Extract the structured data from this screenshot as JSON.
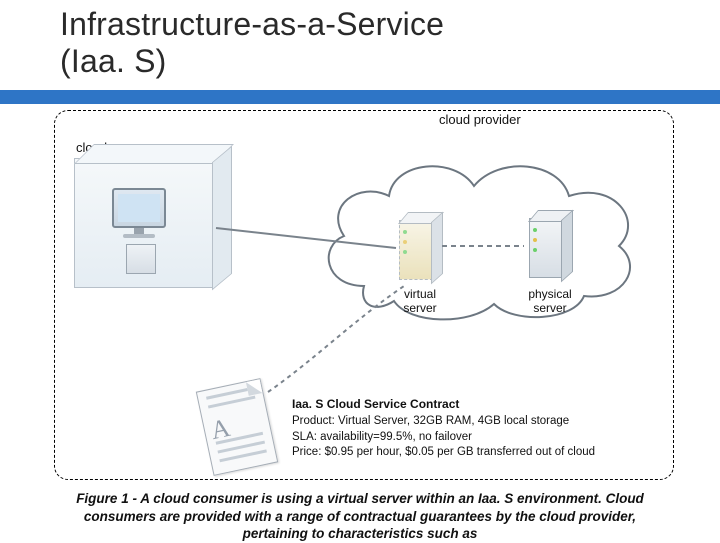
{
  "title_line1": "Infrastructure-as-a-Service",
  "title_line2": "(Iaa. S)",
  "labels": {
    "cloud_provider": "cloud provider",
    "cloud_consumer": "cloud consumer",
    "virtual_server_l1": "virtual",
    "virtual_server_l2": "server",
    "physical_server_l1": "physical",
    "physical_server_l2": "server"
  },
  "contract": {
    "heading": "Iaa. S Cloud Service Contract",
    "product": "Product: Virtual Server, 32GB RAM, 4GB local storage",
    "sla": "SLA: availability=99.5%, no failover",
    "price": "Price: $0.95 per hour, $0.05 per GB transferred out of cloud"
  },
  "caption": "Figure 1 - A cloud consumer is using a virtual server within an Iaa. S environment. Cloud consumers are provided with a range of contractual guarantees by the cloud provider, pertaining to characteristics such as"
}
